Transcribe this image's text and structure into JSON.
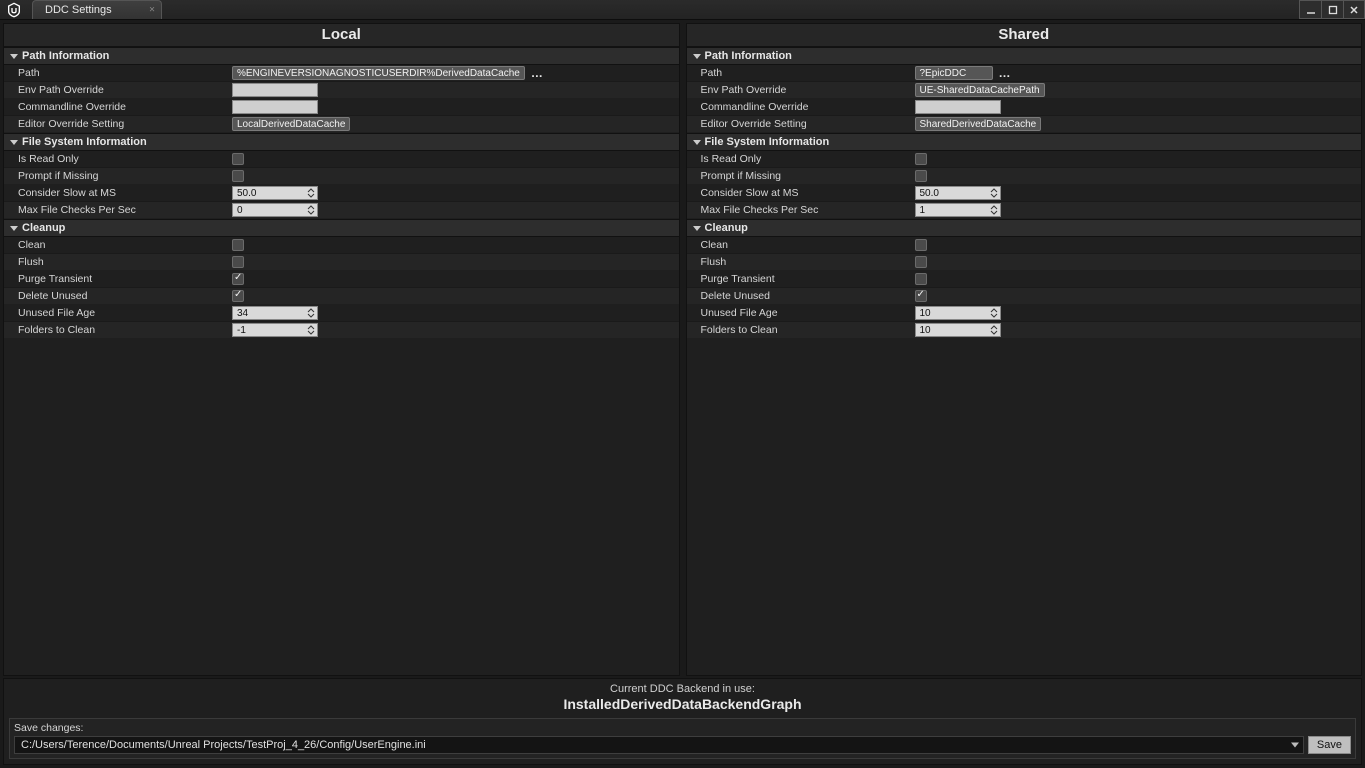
{
  "titlebar": {
    "tab_title": "DDC Settings"
  },
  "columns": {
    "local": {
      "title": "Local",
      "path_info": {
        "header": "Path Information",
        "path_label": "Path",
        "path_value": "%ENGINEVERSIONAGNOSTICUSERDIR%DerivedDataCache",
        "env_override_label": "Env Path Override",
        "env_override_value": "",
        "cmd_override_label": "Commandline Override",
        "cmd_override_value": "",
        "editor_override_label": "Editor Override Setting",
        "editor_override_value": "LocalDerivedDataCache"
      },
      "fs_info": {
        "header": "File System Information",
        "readonly_label": "Is Read Only",
        "readonly": false,
        "prompt_label": "Prompt if Missing",
        "prompt": false,
        "slow_label": "Consider Slow at MS",
        "slow_value": "50.0",
        "maxchecks_label": "Max File Checks Per Sec",
        "maxchecks_value": "0"
      },
      "cleanup": {
        "header": "Cleanup",
        "clean_label": "Clean",
        "clean": false,
        "flush_label": "Flush",
        "flush": false,
        "purge_label": "Purge Transient",
        "purge": true,
        "delete_label": "Delete Unused",
        "delete": true,
        "age_label": "Unused File Age",
        "age_value": "34",
        "folders_label": "Folders to Clean",
        "folders_value": "-1"
      }
    },
    "shared": {
      "title": "Shared",
      "path_info": {
        "header": "Path Information",
        "path_label": "Path",
        "path_value": "?EpicDDC",
        "env_override_label": "Env Path Override",
        "env_override_value": "UE-SharedDataCachePath",
        "cmd_override_label": "Commandline Override",
        "cmd_override_value": "",
        "editor_override_label": "Editor Override Setting",
        "editor_override_value": "SharedDerivedDataCache"
      },
      "fs_info": {
        "header": "File System Information",
        "readonly_label": "Is Read Only",
        "readonly": false,
        "prompt_label": "Prompt if Missing",
        "prompt": false,
        "slow_label": "Consider Slow at MS",
        "slow_value": "50.0",
        "maxchecks_label": "Max File Checks Per Sec",
        "maxchecks_value": "1"
      },
      "cleanup": {
        "header": "Cleanup",
        "clean_label": "Clean",
        "clean": false,
        "flush_label": "Flush",
        "flush": false,
        "purge_label": "Purge Transient",
        "purge": false,
        "delete_label": "Delete Unused",
        "delete": true,
        "age_label": "Unused File Age",
        "age_value": "10",
        "folders_label": "Folders to Clean",
        "folders_value": "10"
      }
    }
  },
  "footer": {
    "backend_label": "Current DDC Backend in use:",
    "backend_name": "InstalledDerivedDataBackendGraph",
    "save_label": "Save changes:",
    "save_path": "C:/Users/Terence/Documents/Unreal Projects/TestProj_4_26/Config/UserEngine.ini",
    "save_button": "Save"
  }
}
